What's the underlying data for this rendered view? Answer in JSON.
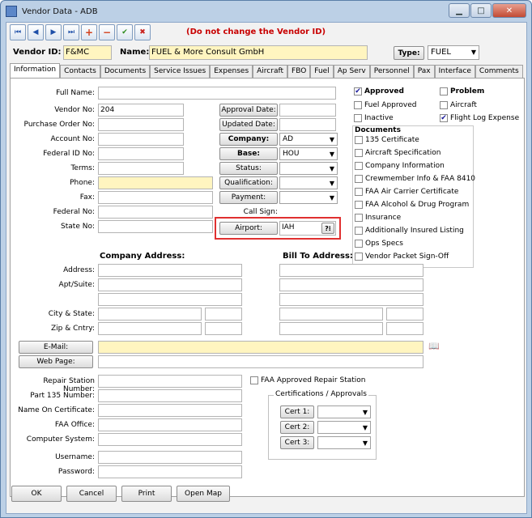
{
  "window": {
    "title": "Vendor Data - ADB"
  },
  "toolbar": {
    "first": "⏮",
    "prev": "◀",
    "next": "▶",
    "last": "⏭",
    "add": "+",
    "delete": "−",
    "save": "✔",
    "cancel": "✖",
    "warning": "(Do not change the Vendor ID)"
  },
  "header": {
    "vendor_id_label": "Vendor ID:",
    "vendor_id": "F&MC",
    "name_label": "Name:",
    "name": "FUEL & More Consult GmbH",
    "type_button": "Type:",
    "type_value": "FUEL"
  },
  "tabs": [
    "Information",
    "Contacts",
    "Documents",
    "Service Issues",
    "Expenses",
    "Aircraft",
    "FBO",
    "Fuel",
    "Ap Serv",
    "Personnel",
    "Pax",
    "Interface",
    "Comments"
  ],
  "info": {
    "full_name_label": "Full Name:",
    "full_name": "",
    "vendor_no_label": "Vendor No:",
    "vendor_no": "204",
    "po_label": "Purchase Order No:",
    "po": "",
    "account_label": "Account No:",
    "account": "",
    "federal_id_label": "Federal ID No:",
    "federal_id": "",
    "terms_label": "Terms:",
    "terms": "",
    "phone_label": "Phone:",
    "phone": "",
    "fax_label": "Fax:",
    "fax": "",
    "federal_no_label": "Federal No:",
    "federal_no": "",
    "state_no_label": "State No:",
    "state_no": "",
    "approval_date_btn": "Approval Date:",
    "approval_date": "",
    "updated_date_btn": "Updated Date:",
    "updated_date": "",
    "company_btn": "Company:",
    "company": "AD",
    "base_btn": "Base:",
    "base": "HOU",
    "status_btn": "Status:",
    "status": "",
    "qualification_btn": "Qualification:",
    "qualification": "",
    "payment_btn": "Payment:",
    "payment": "",
    "call_sign_label": "Call Sign:",
    "call_sign": "",
    "airport_btn": "Airport:",
    "airport": "IAH",
    "airport_help": "?⁝"
  },
  "flags": {
    "approved": "Approved",
    "problem": "Problem",
    "fuel_approved": "Fuel Approved",
    "aircraft": "Aircraft",
    "inactive": "Inactive",
    "flight_log_expense": "Flight Log Expense"
  },
  "documents": {
    "title": "Documents",
    "items": [
      "135 Certificate",
      "Aircraft Specification",
      "Company Information",
      "Crewmember Info & FAA 8410",
      "FAA Air Carrier Certificate",
      "FAA Alcohol & Drug Program",
      "Insurance",
      "Additionally Insured Listing",
      "Ops Specs",
      "Vendor Packet Sign-Off"
    ]
  },
  "address": {
    "company_title": "Company Address:",
    "bill_title": "Bill To Address:",
    "address_label": "Address:",
    "apt_label": "Apt/Suite:",
    "city_label": "City & State:",
    "zip_label": "Zip & Cntry:"
  },
  "contact": {
    "email_btn": "E-Mail:",
    "web_btn": "Web Page:",
    "email": "",
    "web": ""
  },
  "repair": {
    "station_label": "Repair Station Number:",
    "part135_label": "Part 135 Number:",
    "name_cert_label": "Name On Certificate:",
    "faa_office_label": "FAA Office:",
    "computer_label": "Computer System:",
    "username_label": "Username:",
    "password_label": "Password:",
    "faa_approved": "FAA Approved Repair Station",
    "certs_legend": "Certifications / Approvals",
    "cert1": "Cert 1:",
    "cert2": "Cert 2:",
    "cert3": "Cert 3:"
  },
  "footer": {
    "ok": "OK",
    "cancel": "Cancel",
    "print": "Print",
    "open_map": "Open Map"
  },
  "colors": {
    "highlight": "#e03030",
    "yellow_field": "#fff5c0",
    "warning_text": "#c80000"
  }
}
